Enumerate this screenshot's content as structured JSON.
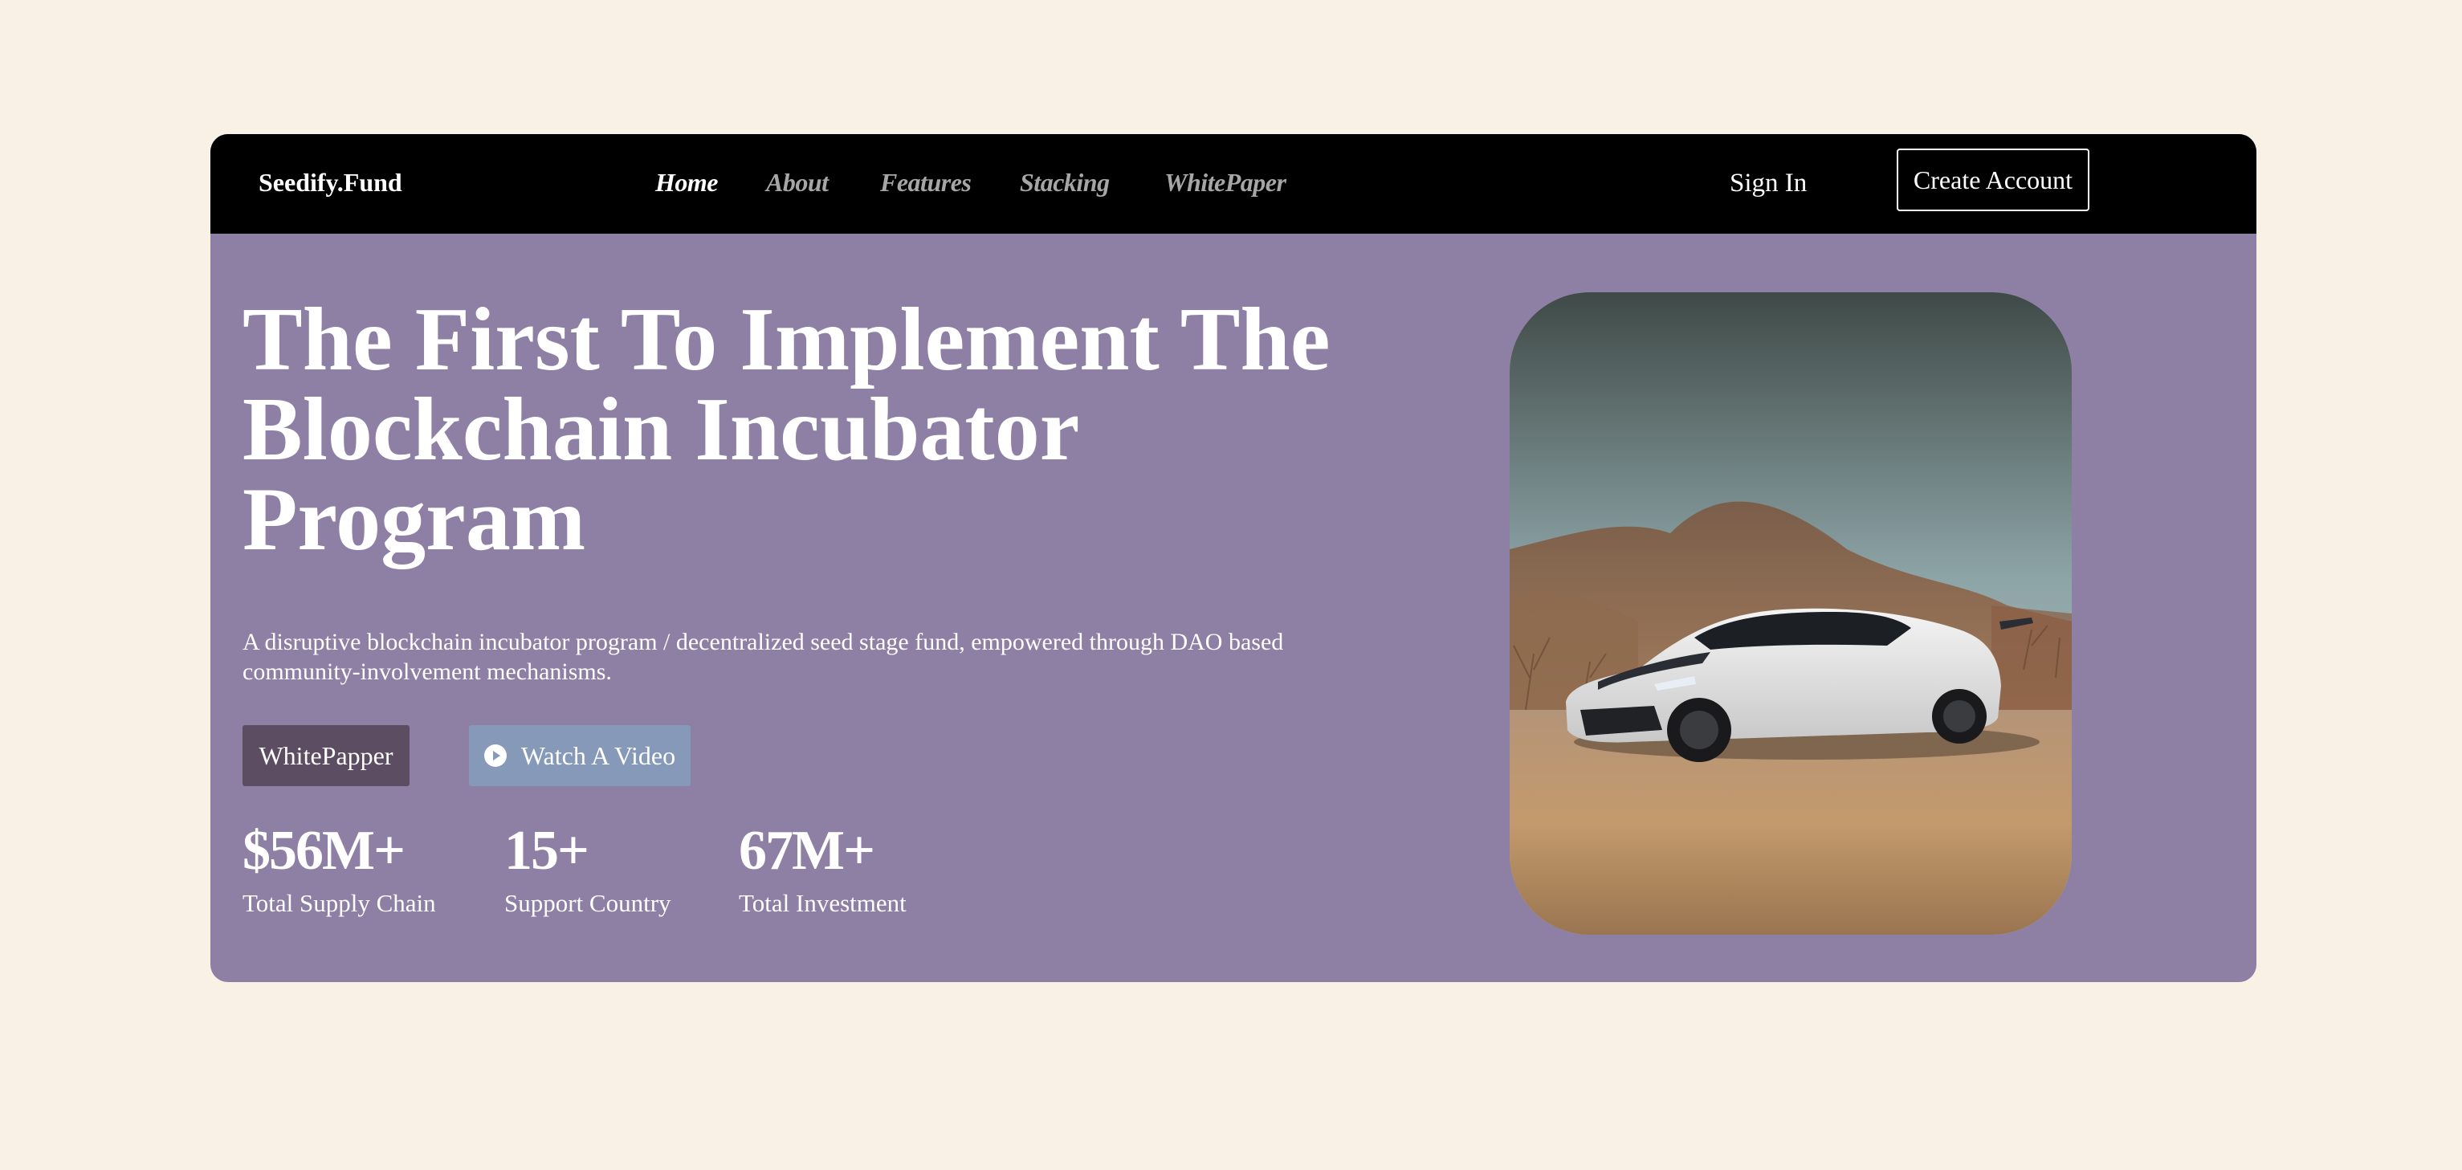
{
  "nav": {
    "brand": "Seedify.Fund",
    "links": [
      {
        "label": "Home",
        "active": true
      },
      {
        "label": "About",
        "active": false
      },
      {
        "label": "Features",
        "active": false
      },
      {
        "label": "Stacking",
        "active": false
      },
      {
        "label": "WhitePaper",
        "active": false
      }
    ],
    "sign_in": "Sign In",
    "create_account": "Create Account"
  },
  "hero": {
    "title_lines": [
      "The First To Implement The",
      "Blockchain Incubator",
      "Program"
    ],
    "description": "A disruptive blockchain incubator program / decentralized seed stage fund, empowered through DAO based community-involvement mechanisms.",
    "buttons": {
      "whitepaper": "WhitePapper",
      "video": "Watch A Video",
      "video_icon": "play-circle-icon"
    },
    "stats": [
      {
        "value": "$56M+",
        "label": "Total Supply Chain"
      },
      {
        "value": "15+",
        "label": "Support Country"
      },
      {
        "value": "67M+",
        "label": "Total Investment"
      }
    ],
    "image_subject": "white sports car parked on a desert dirt road"
  },
  "colors": {
    "page_bg": "#f9f0e6",
    "navbar_bg": "#000000",
    "hero_bg": "#8e7fa5",
    "whitepaper_btn": "#5c4d62",
    "video_btn": "#8699b8",
    "nav_inactive": "#a6a6a6",
    "text": "#ffffff"
  }
}
